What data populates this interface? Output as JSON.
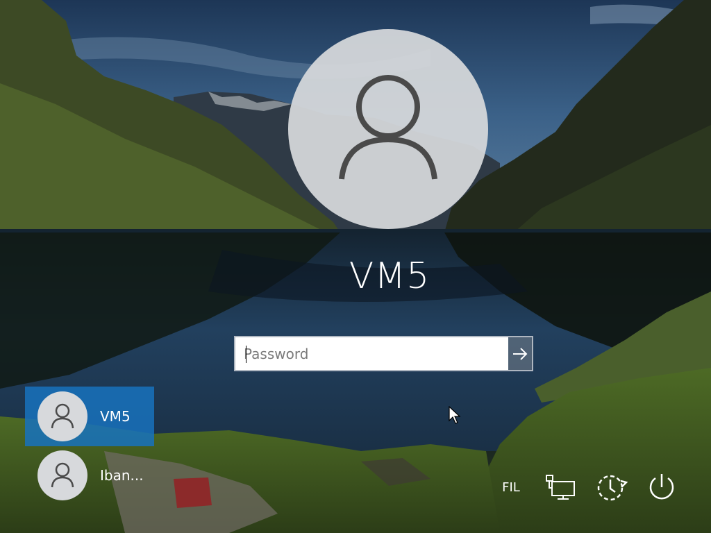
{
  "login": {
    "username": "VM5",
    "password_placeholder": "Password",
    "password_value": ""
  },
  "users": [
    {
      "name": "VM5",
      "selected": true
    },
    {
      "name": "Iban..."
    }
  ],
  "tray": {
    "language": "FIL",
    "icons": [
      "network-icon",
      "ease-of-access-icon",
      "power-icon"
    ]
  },
  "colors": {
    "selected_tile": "#1772bd",
    "avatar_bg": "#d7d9dc",
    "avatar_glyph": "#4a4a4a"
  }
}
